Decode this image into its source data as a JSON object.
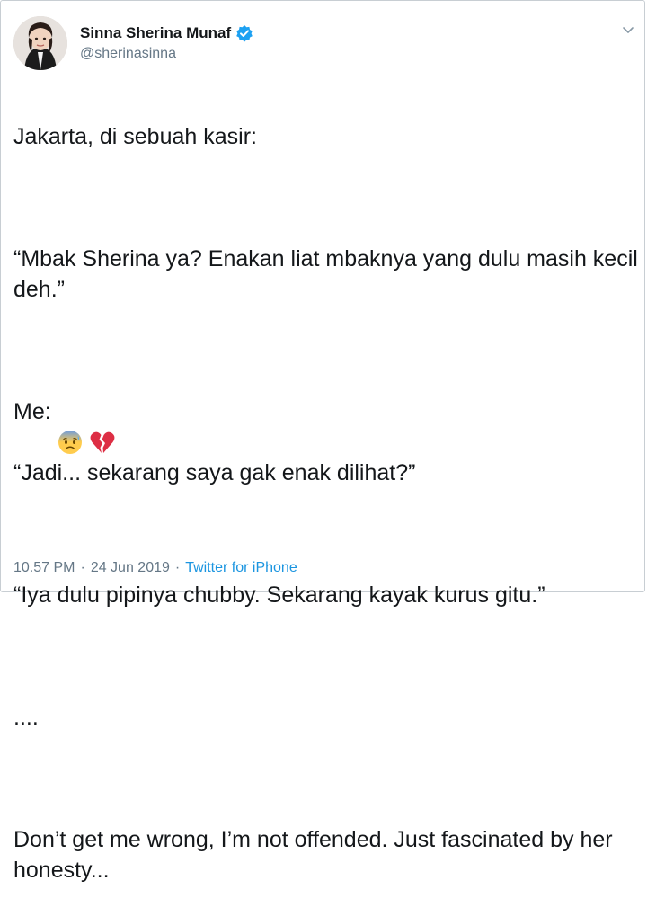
{
  "user": {
    "display_name": "Sinna Sherina Munaf",
    "handle": "@sherinasinna"
  },
  "icons": {
    "verified": "verified-badge-icon",
    "caret": "chevron-down-icon",
    "emoji_1": "anxious-face-with-sweat-emoji",
    "emoji_2": "broken-heart-emoji"
  },
  "tweet": {
    "line1": "Jakarta, di sebuah kasir:",
    "line2": "“Mbak Sherina ya? Enakan liat mbaknya yang dulu masih kecil deh.”",
    "line3_prefix": "Me:",
    "line4": "“Jadi... sekarang saya gak enak dilihat?”",
    "line5": "“Iya dulu pipinya chubby. Sekarang kayak kurus gitu.”",
    "line6": "....",
    "line7": "Don’t get me wrong, I’m not offended. Just fascinated by her honesty..."
  },
  "meta": {
    "time": "10.57 PM",
    "date": "24 Jun 2019",
    "separator": "·",
    "source": "Twitter for iPhone"
  },
  "colors": {
    "text": "#14171a",
    "secondary": "#657786",
    "link": "#1b95e0",
    "verified": "#1da1f2",
    "border": "#c8ced3"
  }
}
